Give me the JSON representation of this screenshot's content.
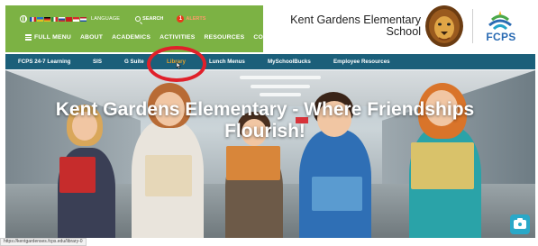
{
  "utility_bar": {
    "language_label": "LANGUAGE",
    "search_label": "SEARCH",
    "alerts_count": "1",
    "alerts_label": "ALERTS",
    "flags": [
      "#c81e1e",
      "#1f4fa5",
      "#2a8a3a",
      "#e3c21e",
      "#b51f2a",
      "#1f6fd0",
      "#d62b2b",
      "#f0f0f0"
    ]
  },
  "main_nav": {
    "full_menu": "FULL MENU",
    "items": [
      "ABOUT",
      "ACADEMICS",
      "ACTIVITIES",
      "RESOURCES",
      "CONTACT"
    ]
  },
  "school": {
    "name_line1": "Kent Gardens Elementary",
    "name_line2": "School",
    "district": "FCPS"
  },
  "sub_nav": {
    "items": [
      "FCPS 24-7 Learning",
      "SIS",
      "G Suite",
      "Library",
      "Lunch Menus",
      "MySchoolBucks",
      "Employee Resources"
    ],
    "highlighted_index": 3,
    "highlight_color": "#e9a52a"
  },
  "hero": {
    "title_line1": "Kent Gardens Elementary - Where Friendships",
    "title_line2": "Flourish!"
  },
  "status_bar": {
    "url": "https://kentgardenses.fcps.edu/library-0"
  },
  "colors": {
    "header_green": "#7cb244",
    "nav_teal": "#1b5f7a",
    "annotation_red": "#e0202a",
    "camera_teal": "#2aa8c8"
  }
}
